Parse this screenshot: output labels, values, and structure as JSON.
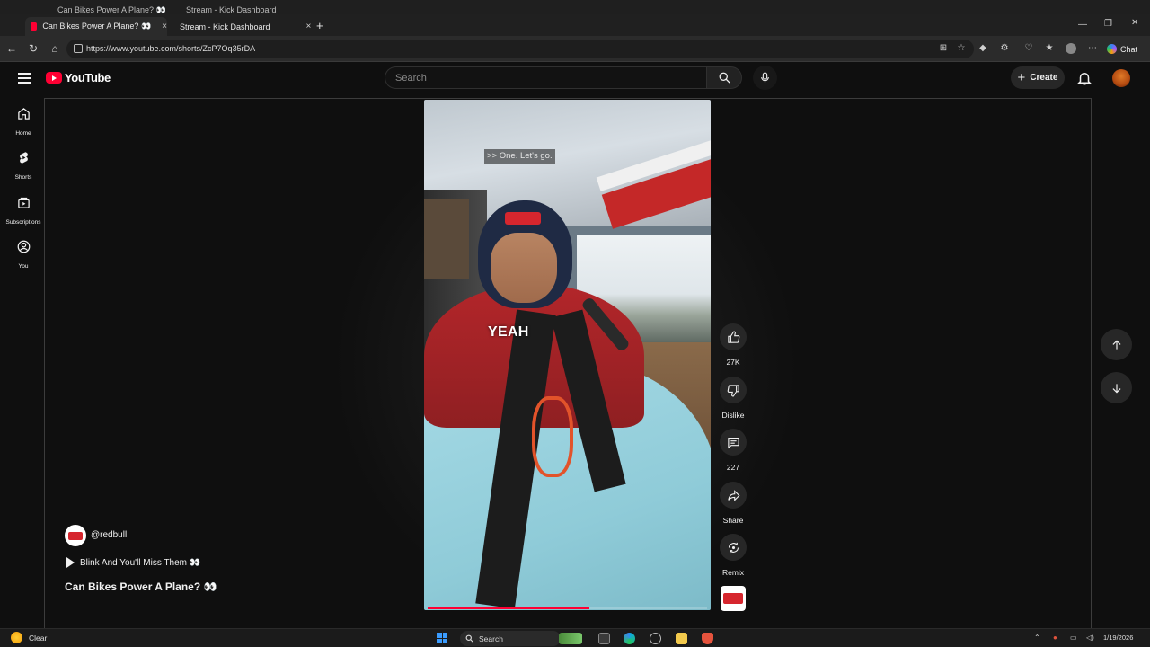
{
  "browser": {
    "ghost_tabs": [
      {
        "label": "Can Bikes Power A Plane? 👀"
      },
      {
        "label": "Stream - Kick Dashboard"
      }
    ],
    "tabs": [
      {
        "label": "Can Bikes Power A Plane? 👀",
        "active": true,
        "favicon_color": "#ff0033"
      },
      {
        "label": "Stream - Kick Dashboard",
        "active": false,
        "favicon_color": "#53fc18"
      }
    ],
    "close_glyph": "×",
    "new_tab_glyph": "+",
    "url": "https://www.youtube.com/shorts/ZcP7Oq35rDA",
    "chat_label": "Chat"
  },
  "youtube": {
    "logo_text": "YouTube",
    "search_placeholder": "Search",
    "create_label": "Create",
    "guide": [
      {
        "label": "Home",
        "icon": "home-icon"
      },
      {
        "label": "Shorts",
        "icon": "shorts-icon"
      },
      {
        "label": "Subscriptions",
        "icon": "subscriptions-icon"
      },
      {
        "label": "You",
        "icon": "you-icon"
      }
    ],
    "short": {
      "caption": ">> One. Let's go.",
      "overlay_word": "YEAH",
      "progress_fraction": 0.58,
      "channel_handle": "@redbull",
      "playlist": "Blink And You'll Miss Them 👀",
      "title": "Can Bikes Power A Plane? 👀"
    },
    "actions": [
      {
        "label": "27K",
        "icon": "like-icon"
      },
      {
        "label": "Dislike",
        "icon": "dislike-icon"
      },
      {
        "label": "227",
        "icon": "comment-icon"
      },
      {
        "label": "Share",
        "icon": "share-icon"
      },
      {
        "label": "Remix",
        "icon": "remix-icon"
      }
    ]
  },
  "taskbar": {
    "weather_text": "Clear",
    "search_label": "Search",
    "date": "1/19/2026"
  }
}
